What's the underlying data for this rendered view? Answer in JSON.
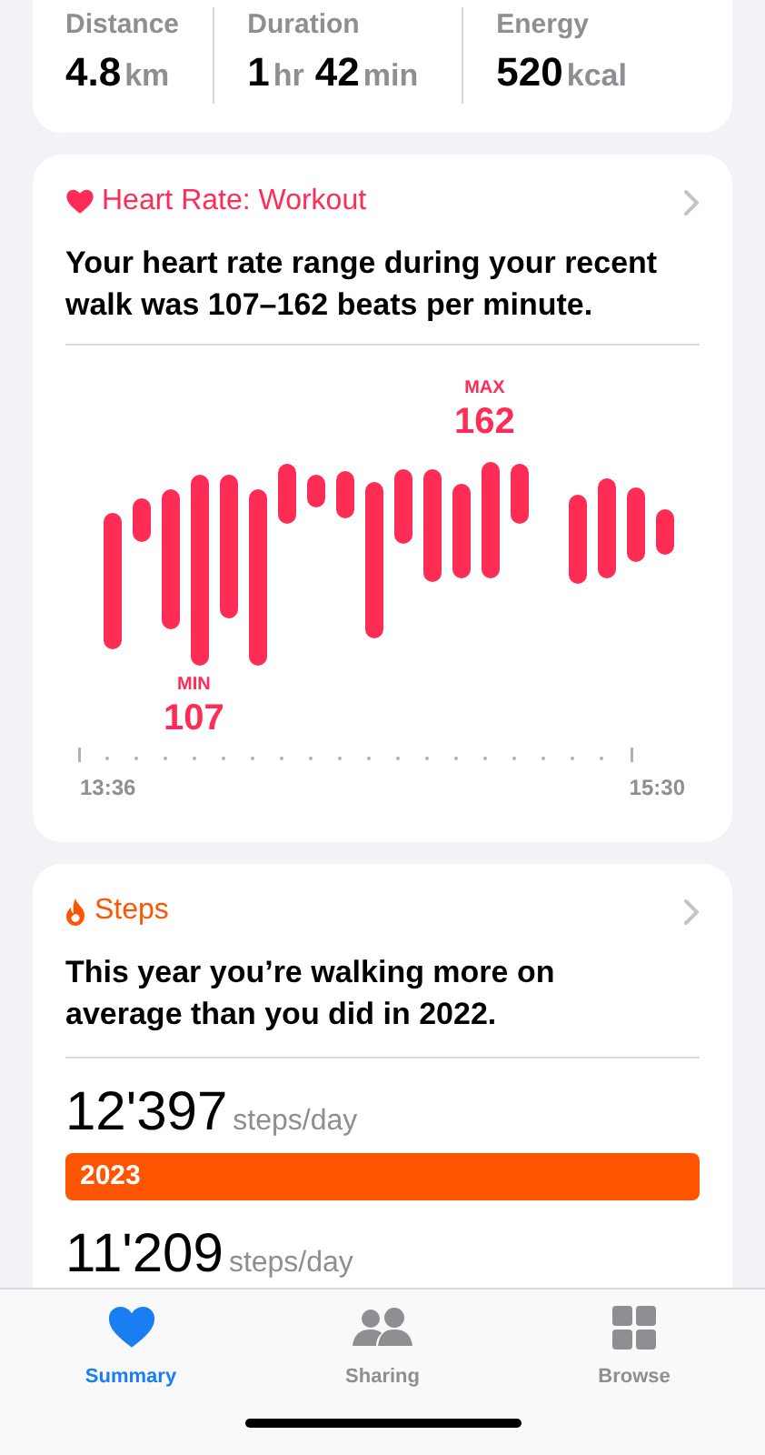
{
  "workout_stats": [
    {
      "label": "Distance",
      "parts": [
        {
          "kind": "value",
          "text": "4.8"
        },
        {
          "kind": "unit",
          "text": "km"
        }
      ]
    },
    {
      "label": "Duration",
      "parts": [
        {
          "kind": "value",
          "text": "1"
        },
        {
          "kind": "unit",
          "text": "hr"
        },
        {
          "kind": "value",
          "text": "42"
        },
        {
          "kind": "unit",
          "text": "min"
        }
      ]
    },
    {
      "label": "Energy",
      "parts": [
        {
          "kind": "value",
          "text": "520"
        },
        {
          "kind": "unit",
          "text": "kcal"
        }
      ]
    }
  ],
  "heart_rate_card": {
    "title": "Heart Rate: Workout",
    "summary": "Your heart rate range during your recent walk was 107–162 beats per minute.",
    "max_label": "MAX",
    "max_value": "162",
    "min_label": "MIN",
    "min_value": "107",
    "start_time": "13:36",
    "end_time": "15:30"
  },
  "steps_card": {
    "title": "Steps",
    "summary": "This year you’re walking more on average than you did in 2022.",
    "rows": [
      {
        "value": "12'397",
        "unit": "steps/day",
        "bar_label": "2023"
      },
      {
        "value": "11'209",
        "unit": "steps/day"
      }
    ]
  },
  "tab_bar": [
    {
      "label": "Summary",
      "kind": "heart",
      "selected": true
    },
    {
      "label": "Sharing",
      "kind": "people",
      "selected": false
    },
    {
      "label": "Browse",
      "kind": "grid",
      "selected": false
    }
  ]
}
